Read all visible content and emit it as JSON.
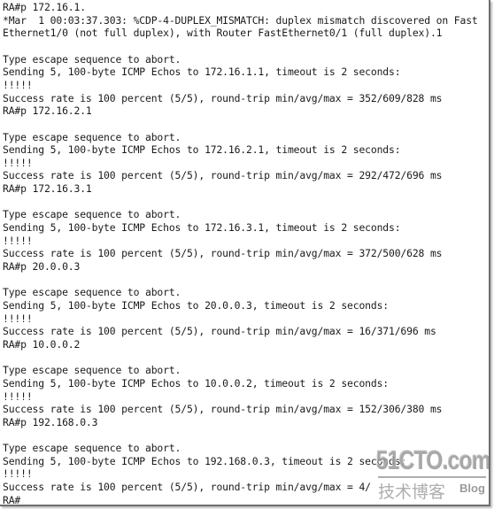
{
  "terminal": {
    "lines": [
      "RA#p 172.16.1.",
      "*Mar  1 00:03:37.303: %CDP-4-DUPLEX_MISMATCH: duplex mismatch discovered on Fast",
      "Ethernet1/0 (not full duplex), with Router FastEthernet0/1 (full duplex).1",
      "",
      "Type escape sequence to abort.",
      "Sending 5, 100-byte ICMP Echos to 172.16.1.1, timeout is 2 seconds:",
      "!!!!!",
      "Success rate is 100 percent (5/5), round-trip min/avg/max = 352/609/828 ms",
      "RA#p 172.16.2.1",
      "",
      "Type escape sequence to abort.",
      "Sending 5, 100-byte ICMP Echos to 172.16.2.1, timeout is 2 seconds:",
      "!!!!!",
      "Success rate is 100 percent (5/5), round-trip min/avg/max = 292/472/696 ms",
      "RA#p 172.16.3.1",
      "",
      "Type escape sequence to abort.",
      "Sending 5, 100-byte ICMP Echos to 172.16.3.1, timeout is 2 seconds:",
      "!!!!!",
      "Success rate is 100 percent (5/5), round-trip min/avg/max = 372/500/628 ms",
      "RA#p 20.0.0.3",
      "",
      "Type escape sequence to abort.",
      "Sending 5, 100-byte ICMP Echos to 20.0.0.3, timeout is 2 seconds:",
      "!!!!!",
      "Success rate is 100 percent (5/5), round-trip min/avg/max = 16/371/696 ms",
      "RA#p 10.0.0.2",
      "",
      "Type escape sequence to abort.",
      "Sending 5, 100-byte ICMP Echos to 10.0.0.2, timeout is 2 seconds:",
      "!!!!!",
      "Success rate is 100 percent (5/5), round-trip min/avg/max = 152/306/380 ms",
      "RA#p 192.168.0.3",
      "",
      "Type escape sequence to abort.",
      "Sending 5, 100-byte ICMP Echos to 192.168.0.3, timeout is 2 seconds:",
      "!!!!!",
      "Success rate is 100 percent (5/5), round-trip min/avg/max = 4/",
      "RA#"
    ]
  },
  "watermark": {
    "logo": "51CTO.com",
    "subtitle": "技术博客",
    "blog": "Blog"
  }
}
